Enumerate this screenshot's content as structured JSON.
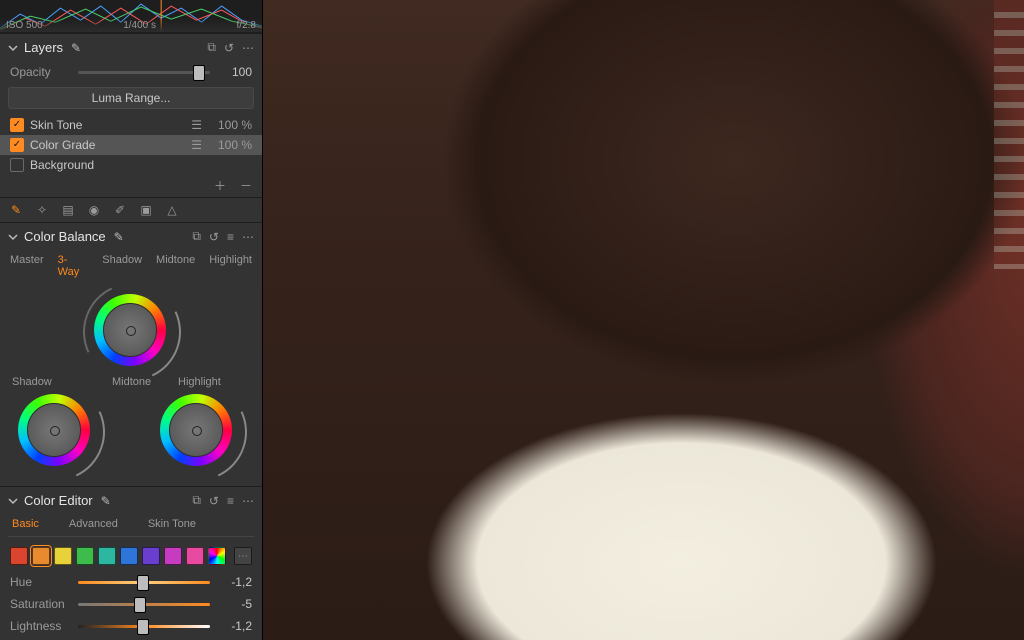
{
  "histogram": {
    "iso": "ISO 500",
    "shutter": "1/400 s",
    "aperture": "f/2.8"
  },
  "layers": {
    "title": "Layers",
    "opacity_label": "Opacity",
    "opacity_value": "100",
    "luma_button": "Luma Range...",
    "items": [
      {
        "name": "Skin Tone",
        "checked": true,
        "opacity": "100 %",
        "selected": false,
        "has_adjust": true
      },
      {
        "name": "Color Grade",
        "checked": true,
        "opacity": "100 %",
        "selected": true,
        "has_adjust": true
      },
      {
        "name": "Background",
        "checked": false,
        "opacity": "",
        "selected": false,
        "has_adjust": false
      }
    ]
  },
  "color_balance": {
    "title": "Color Balance",
    "tabs": [
      "Master",
      "3-Way",
      "Shadow",
      "Midtone",
      "Highlight"
    ],
    "active_tab": "3-Way",
    "wheel_labels": {
      "shadow": "Shadow",
      "midtone": "Midtone",
      "highlight": "Highlight"
    }
  },
  "color_editor": {
    "title": "Color Editor",
    "tabs": [
      "Basic",
      "Advanced",
      "Skin Tone"
    ],
    "active_tab": "Basic",
    "swatches": [
      "#d9452e",
      "#e88a2d",
      "#e8d23a",
      "#3dbb4d",
      "#2eb7a0",
      "#2e74d9",
      "#6a3fd0",
      "#c63bc0",
      "#e84aa0",
      "rainbow"
    ],
    "selected_swatch": 1,
    "sliders": {
      "hue": {
        "label": "Hue",
        "value": "-1,2",
        "pos": 0.49
      },
      "saturation": {
        "label": "Saturation",
        "value": "-5",
        "pos": 0.47
      },
      "lightness": {
        "label": "Lightness",
        "value": "-1,2",
        "pos": 0.49
      }
    }
  }
}
